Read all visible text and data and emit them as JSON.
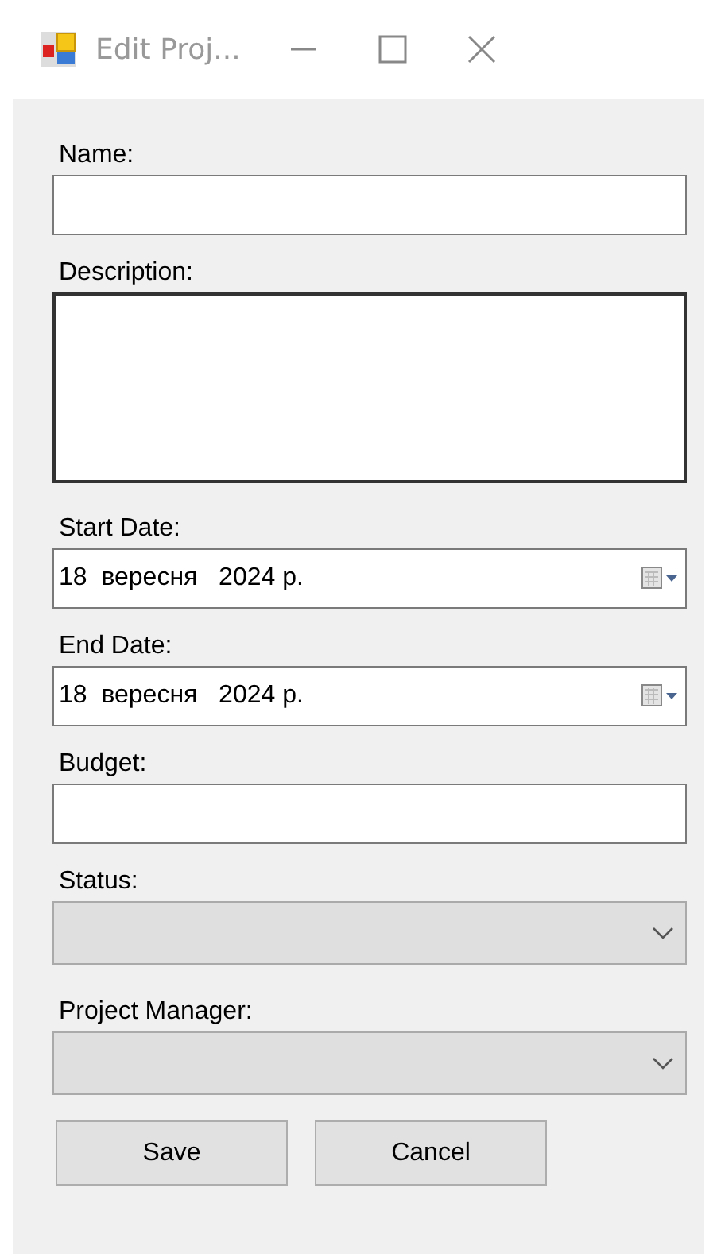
{
  "window": {
    "title": "Edit Proj..."
  },
  "fields": [
    {
      "kind": "text",
      "label": "Name:"
    },
    {
      "kind": "multiline",
      "label": "Description:"
    },
    {
      "kind": "date",
      "label": "Start Date:",
      "value": "18  вересня   2024 р."
    },
    {
      "kind": "date",
      "label": "End Date:",
      "value": "18  вересня   2024 р."
    },
    {
      "kind": "text",
      "label": "Budget:"
    },
    {
      "kind": "combo",
      "label": "Status:",
      "disabled": true
    },
    {
      "kind": "combo",
      "label": "Project Manager:",
      "disabled": true
    }
  ],
  "buttons": [
    "Save",
    "Cancel"
  ]
}
